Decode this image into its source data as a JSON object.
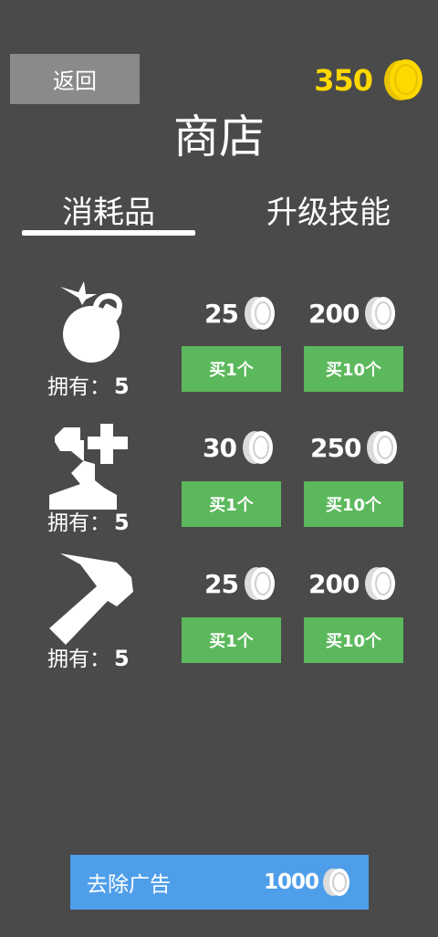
{
  "header": {
    "back_label": "返回",
    "coin_balance": "350",
    "title": "商店"
  },
  "tabs": [
    {
      "label": "消耗品",
      "active": true
    },
    {
      "label": "升级技能",
      "active": false
    }
  ],
  "items": [
    {
      "icon": "bomb-icon",
      "owned_label": "拥有：",
      "owned_count": "5",
      "price_1": "25",
      "price_10": "200",
      "buy_1_label": "买1个",
      "buy_10_label": "买10个"
    },
    {
      "icon": "health-potion-icon",
      "owned_label": "拥有：",
      "owned_count": "5",
      "price_1": "30",
      "price_10": "250",
      "buy_1_label": "买1个",
      "buy_10_label": "买10个"
    },
    {
      "icon": "hammer-icon",
      "owned_label": "拥有：",
      "owned_count": "5",
      "price_1": "25",
      "price_10": "200",
      "buy_1_label": "买1个",
      "buy_10_label": "买10个"
    }
  ],
  "remove_ads": {
    "label": "去除广告",
    "price": "1000"
  },
  "colors": {
    "background": "#4a4a4a",
    "coin_gold": "#ffd800",
    "buy_green": "#5cb85c",
    "ad_blue": "#4f9eea",
    "back_gray": "#8a8a8a"
  }
}
